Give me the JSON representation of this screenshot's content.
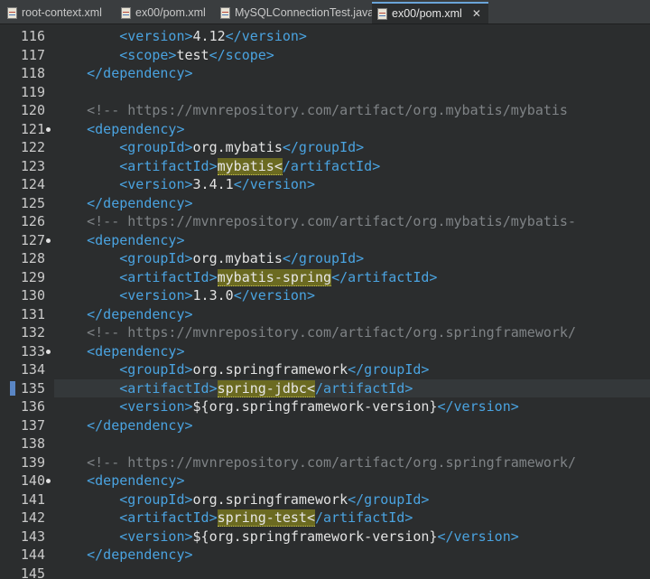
{
  "tabs": [
    {
      "label": "root-context.xml",
      "active": false,
      "icon": "xml-file-icon"
    },
    {
      "label": "ex00/pom.xml",
      "active": false,
      "icon": "maven-pom-icon"
    },
    {
      "label": "MySQLConnectionTest.java",
      "active": false,
      "icon": "java-file-icon"
    },
    {
      "label": "ex00/pom.xml",
      "active": true,
      "icon": "maven-pom-icon",
      "close": "✕"
    }
  ],
  "editor": {
    "lines": [
      {
        "num": "116",
        "indent": "        ",
        "tokens": [
          {
            "k": "t",
            "v": "<version>"
          },
          {
            "k": "txt",
            "v": "4.12"
          },
          {
            "k": "t",
            "v": "</version>"
          }
        ]
      },
      {
        "num": "117",
        "indent": "        ",
        "tokens": [
          {
            "k": "t",
            "v": "<scope>"
          },
          {
            "k": "txt",
            "v": "test"
          },
          {
            "k": "t",
            "v": "</scope>"
          }
        ]
      },
      {
        "num": "118",
        "indent": "    ",
        "tokens": [
          {
            "k": "t",
            "v": "</dependency>"
          }
        ]
      },
      {
        "num": "119",
        "indent": "",
        "tokens": []
      },
      {
        "num": "120",
        "indent": "    ",
        "tokens": [
          {
            "k": "cm",
            "v": "<!-- https://mvnrepository.com/artifact/org.mybatis/mybatis"
          }
        ]
      },
      {
        "num": "121",
        "indent": "    ",
        "fold": true,
        "tokens": [
          {
            "k": "t",
            "v": "<dependency>"
          }
        ]
      },
      {
        "num": "122",
        "indent": "        ",
        "tokens": [
          {
            "k": "t",
            "v": "<groupId>"
          },
          {
            "k": "txt",
            "v": "org.mybatis"
          },
          {
            "k": "t",
            "v": "</groupId>"
          }
        ]
      },
      {
        "num": "123",
        "indent": "        ",
        "tokens": [
          {
            "k": "t",
            "v": "<artifactId>"
          },
          {
            "k": "hl",
            "v": "mybatis<"
          },
          {
            "k": "t",
            "v": "/artifactId>"
          }
        ]
      },
      {
        "num": "124",
        "indent": "        ",
        "tokens": [
          {
            "k": "t",
            "v": "<version>"
          },
          {
            "k": "txt",
            "v": "3.4.1"
          },
          {
            "k": "t",
            "v": "</version>"
          }
        ]
      },
      {
        "num": "125",
        "indent": "    ",
        "tokens": [
          {
            "k": "t",
            "v": "</dependency>"
          }
        ]
      },
      {
        "num": "126",
        "indent": "    ",
        "tokens": [
          {
            "k": "cm",
            "v": "<!-- https://mvnrepository.com/artifact/org.mybatis/mybatis-"
          }
        ]
      },
      {
        "num": "127",
        "indent": "    ",
        "fold": true,
        "tokens": [
          {
            "k": "t",
            "v": "<dependency>"
          }
        ]
      },
      {
        "num": "128",
        "indent": "        ",
        "tokens": [
          {
            "k": "t",
            "v": "<groupId>"
          },
          {
            "k": "txt",
            "v": "org.mybatis"
          },
          {
            "k": "t",
            "v": "</groupId>"
          }
        ]
      },
      {
        "num": "129",
        "indent": "        ",
        "tokens": [
          {
            "k": "t",
            "v": "<artifactId>"
          },
          {
            "k": "hl",
            "v": "mybatis-spring"
          },
          {
            "k": "t",
            "v": "</artifactId>"
          }
        ]
      },
      {
        "num": "130",
        "indent": "        ",
        "tokens": [
          {
            "k": "t",
            "v": "<version>"
          },
          {
            "k": "txt",
            "v": "1.3.0"
          },
          {
            "k": "t",
            "v": "</version>"
          }
        ]
      },
      {
        "num": "131",
        "indent": "    ",
        "tokens": [
          {
            "k": "t",
            "v": "</dependency>"
          }
        ]
      },
      {
        "num": "132",
        "indent": "    ",
        "tokens": [
          {
            "k": "cm",
            "v": "<!-- https://mvnrepository.com/artifact/org.springframework/"
          }
        ]
      },
      {
        "num": "133",
        "indent": "    ",
        "fold": true,
        "tokens": [
          {
            "k": "t",
            "v": "<dependency>"
          }
        ]
      },
      {
        "num": "134",
        "indent": "        ",
        "tokens": [
          {
            "k": "t",
            "v": "<groupId>"
          },
          {
            "k": "txt",
            "v": "org.springframework"
          },
          {
            "k": "t",
            "v": "</groupId>"
          }
        ]
      },
      {
        "num": "135",
        "indent": "        ",
        "current": true,
        "tokens": [
          {
            "k": "t",
            "v": "<artifactId>"
          },
          {
            "k": "hl",
            "v": "spring-jdbc<"
          },
          {
            "k": "t",
            "v": "/artifactId>"
          }
        ]
      },
      {
        "num": "136",
        "indent": "        ",
        "tokens": [
          {
            "k": "t",
            "v": "<version>"
          },
          {
            "k": "txt",
            "v": "${org.springframework-version}"
          },
          {
            "k": "t",
            "v": "</version>"
          }
        ]
      },
      {
        "num": "137",
        "indent": "    ",
        "tokens": [
          {
            "k": "t",
            "v": "</dependency>"
          }
        ]
      },
      {
        "num": "138",
        "indent": "",
        "tokens": []
      },
      {
        "num": "139",
        "indent": "    ",
        "tokens": [
          {
            "k": "cm",
            "v": "<!-- https://mvnrepository.com/artifact/org.springframework/"
          }
        ]
      },
      {
        "num": "140",
        "indent": "    ",
        "fold": true,
        "tokens": [
          {
            "k": "t",
            "v": "<dependency>"
          }
        ]
      },
      {
        "num": "141",
        "indent": "        ",
        "tokens": [
          {
            "k": "t",
            "v": "<groupId>"
          },
          {
            "k": "txt",
            "v": "org.springframework"
          },
          {
            "k": "t",
            "v": "</groupId>"
          }
        ]
      },
      {
        "num": "142",
        "indent": "        ",
        "tokens": [
          {
            "k": "t",
            "v": "<artifactId>"
          },
          {
            "k": "hl",
            "v": "spring-test<"
          },
          {
            "k": "t",
            "v": "/artifactId>"
          }
        ]
      },
      {
        "num": "143",
        "indent": "        ",
        "tokens": [
          {
            "k": "t",
            "v": "<version>"
          },
          {
            "k": "txt",
            "v": "${org.springframework-version}"
          },
          {
            "k": "t",
            "v": "</version>"
          }
        ]
      },
      {
        "num": "144",
        "indent": "    ",
        "tokens": [
          {
            "k": "t",
            "v": "</dependency>"
          }
        ]
      },
      {
        "num": "145",
        "indent": "",
        "tokens": []
      }
    ]
  }
}
